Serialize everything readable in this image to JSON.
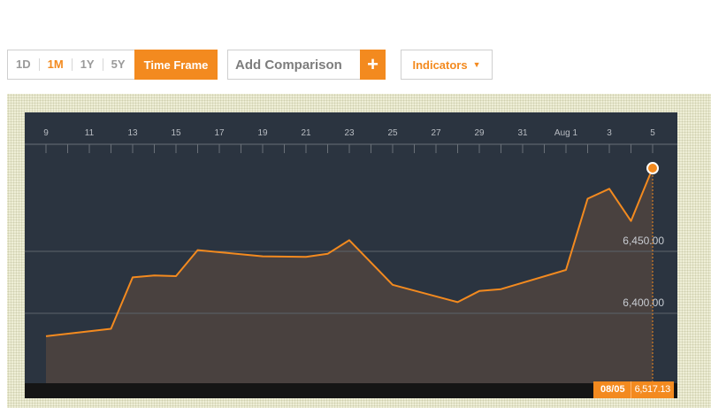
{
  "toolbar": {
    "ranges": [
      {
        "label": "1D",
        "active": false
      },
      {
        "label": "1M",
        "active": true
      },
      {
        "label": "1Y",
        "active": false
      },
      {
        "label": "5Y",
        "active": false
      }
    ],
    "timeframe_label": "Time Frame",
    "comparison_placeholder": "Add Comparison",
    "add_symbol": "+",
    "indicators_label": "Indicators",
    "indicators_caret": "▼"
  },
  "colors": {
    "accent": "#f38a1f",
    "panel_bg": "#2b3440",
    "area_fill": "#4b423f",
    "grid": "#5c636b"
  },
  "tooltip": {
    "date": "08/05",
    "value": "6,517.13"
  },
  "chart_data": {
    "type": "area",
    "title": "",
    "xlabel": "",
    "ylabel": "",
    "x_tick_labels": [
      "9",
      "11",
      "13",
      "15",
      "17",
      "19",
      "21",
      "23",
      "25",
      "27",
      "29",
      "31",
      "Aug 1",
      "3",
      "5"
    ],
    "y_tick_labels": [
      "6,450.00",
      "6,400.00"
    ],
    "y_ticks": [
      6450,
      6400
    ],
    "ylim": [
      6345,
      6522
    ],
    "x_domain": [
      0,
      28
    ],
    "grid": true,
    "series": [
      {
        "x": [
          0,
          3,
          4,
          5,
          6,
          7,
          10,
          12,
          13,
          14,
          16,
          19,
          20,
          21,
          24,
          25,
          26,
          27,
          27.5,
          28
        ],
        "y": [
          6381.5,
          6387.5,
          6429,
          6430.5,
          6430,
          6451,
          6446,
          6445.5,
          6448,
          6459,
          6423,
          6409,
          6418,
          6419.5,
          6435,
          6492.5,
          6500.5,
          6474.5,
          6496,
          6517.13
        ]
      }
    ]
  }
}
